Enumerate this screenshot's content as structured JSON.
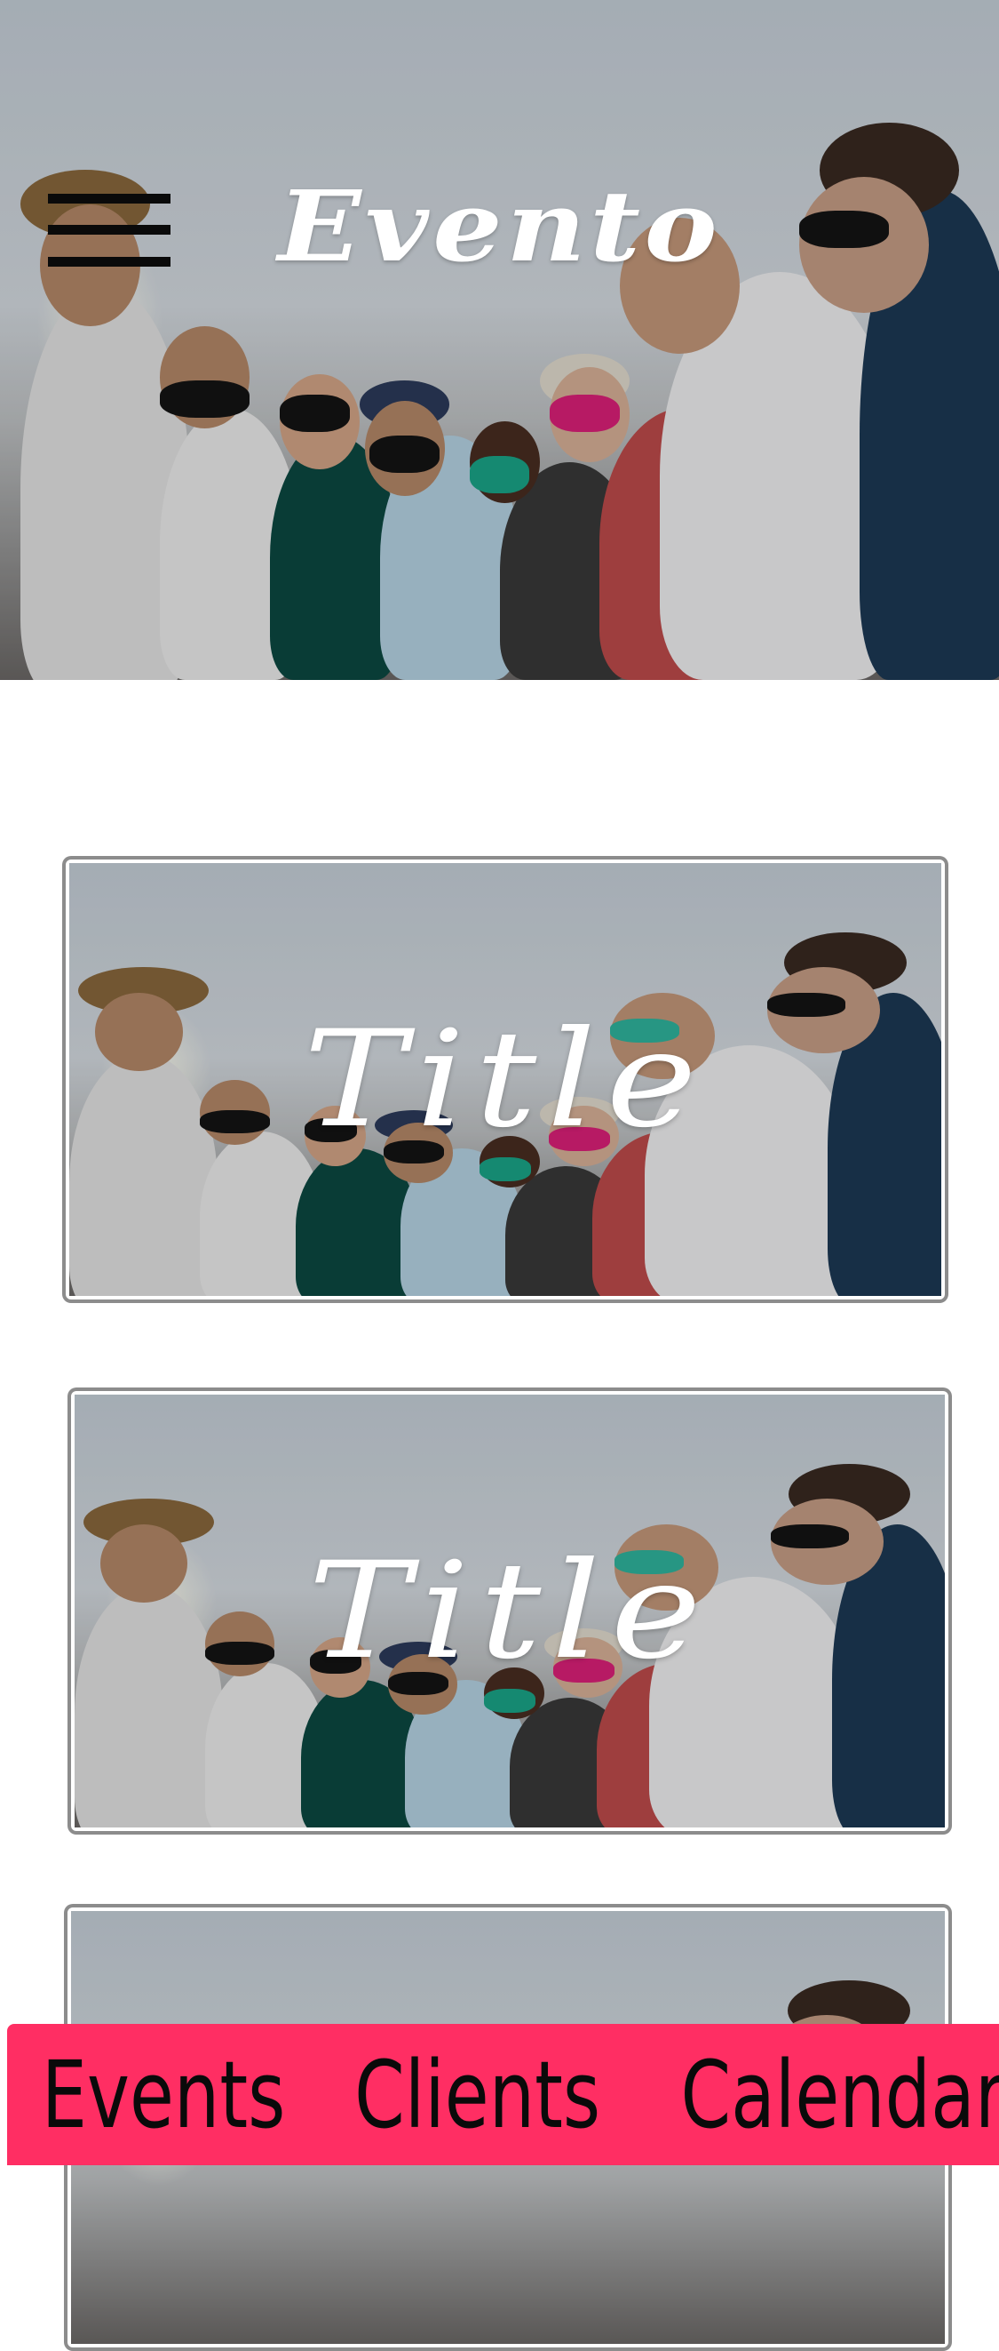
{
  "header": {
    "app_title": "Evento"
  },
  "menu": {
    "icon": "hamburger-menu-icon"
  },
  "cards": [
    {
      "title": "Title"
    },
    {
      "title": "Title"
    },
    {
      "title": ""
    }
  ],
  "tabs": [
    {
      "label": "Events"
    },
    {
      "label": "Clients"
    },
    {
      "label": "Calendar"
    }
  ],
  "colors": {
    "tabbar": "#ff2e63",
    "title_text": "#ffffff"
  }
}
